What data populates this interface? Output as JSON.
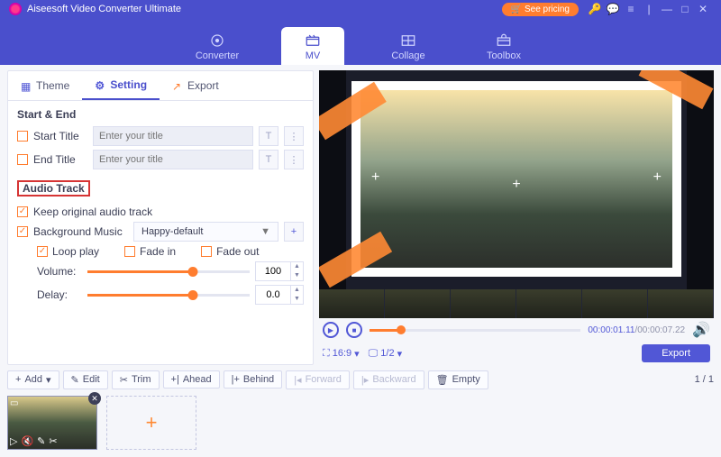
{
  "app": {
    "title": "Aiseesoft Video Converter Ultimate",
    "pricing": "See pricing"
  },
  "nav": {
    "converter": "Converter",
    "mv": "MV",
    "collage": "Collage",
    "toolbox": "Toolbox"
  },
  "tabs": {
    "theme": "Theme",
    "setting": "Setting",
    "export": "Export"
  },
  "section": {
    "startend": "Start & End",
    "audiotrack": "Audio Track"
  },
  "start_end": {
    "start_label": "Start Title",
    "start_placeholder": "Enter your title",
    "end_label": "End Title",
    "end_placeholder": "Enter your title"
  },
  "audio": {
    "keep_original": "Keep original audio track",
    "bgm": "Background Music",
    "bgm_selected": "Happy-default",
    "loop": "Loop play",
    "fadein": "Fade in",
    "fadeout": "Fade out",
    "volume_label": "Volume:",
    "volume_value": "100",
    "delay_label": "Delay:",
    "delay_value": "0.0"
  },
  "playback": {
    "current": "00:00:01.11",
    "total": "00:00:07.22",
    "aspect": "16:9",
    "page": "1/2"
  },
  "export": "Export",
  "toolbar": {
    "add": "Add",
    "edit": "Edit",
    "trim": "Trim",
    "ahead": "Ahead",
    "behind": "Behind",
    "forward": "Forward",
    "backward": "Backward",
    "empty": "Empty"
  },
  "pager": "1 / 1"
}
